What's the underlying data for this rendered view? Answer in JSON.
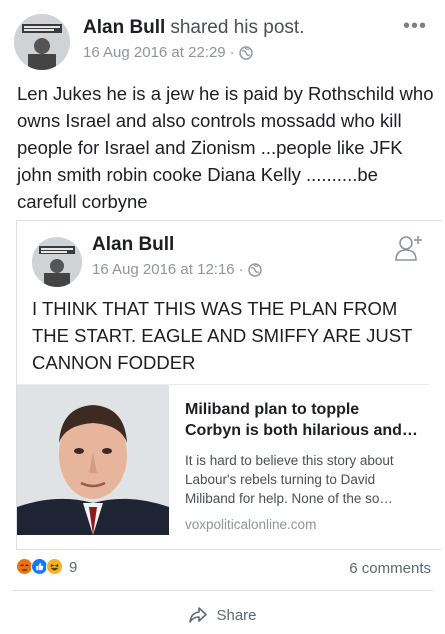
{
  "post": {
    "author": "Alan Bull",
    "action": "shared his post.",
    "timestamp": "16 Aug 2016 at 22:29",
    "separator": "·",
    "privacy_icon": "globe-icon",
    "more_icon": "more-options-icon",
    "text": "Len Jukes he is a jew he is paid by Rothschild who owns Israel and also controls mossadd who kill people for Israel and Zionism ...people like JFK john smith robin cooke Diana Kelly ..........be carefull corbyne"
  },
  "shared": {
    "author": "Alan Bull",
    "timestamp": "16 Aug 2016 at 12:16",
    "separator": "·",
    "add_friend_icon": "add-friend-icon",
    "text": "I THINK THAT THIS WAS THE PLAN FROM THE START. EAGLE AND SMIFFY ARE JUST CANNON FODDER",
    "link": {
      "title": "Miliband plan to topple Corbyn is both hilarious and…",
      "description": "It is hard to believe this story about Labour's rebels turning to David Miliband for help. None of the so…",
      "domain": "voxpoliticalonline.com"
    }
  },
  "footer": {
    "reaction_icons": [
      "angry-react-icon",
      "like-react-icon",
      "haha-react-icon"
    ],
    "reaction_count": "9",
    "comments": "6 comments",
    "share_label": "Share"
  },
  "colors": {
    "like": "#1877f2",
    "angry": "#e9710f",
    "haha": "#f7b125",
    "meta": "#90949c"
  }
}
